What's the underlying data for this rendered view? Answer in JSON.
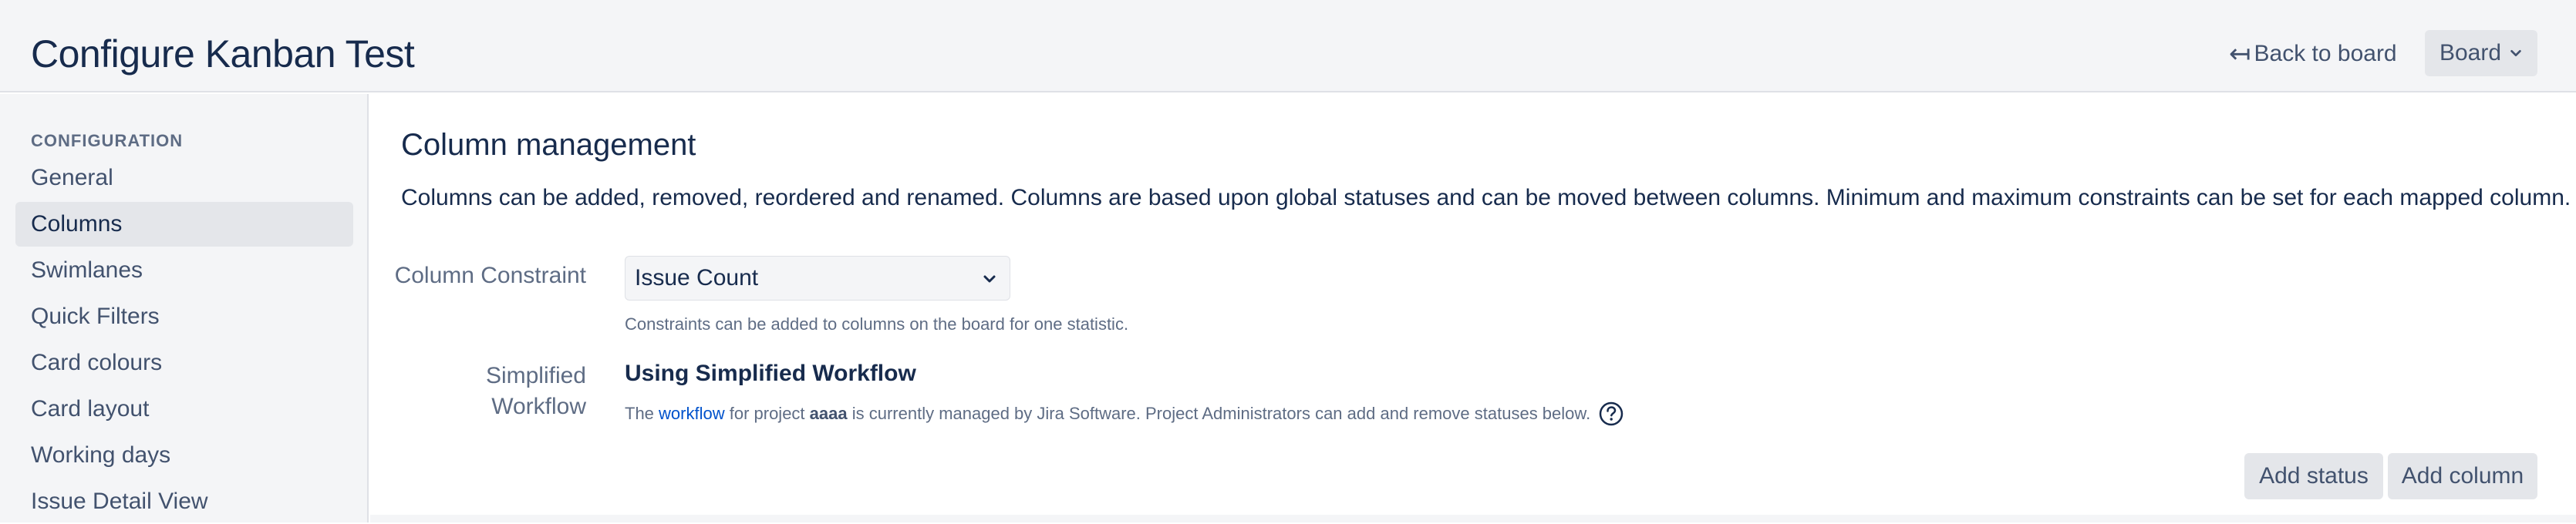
{
  "header": {
    "title": "Configure Kanban Test",
    "back_label": "Back to board",
    "back_arrow": "↤",
    "board_label": "Board"
  },
  "sidebar": {
    "heading": "CONFIGURATION",
    "items": [
      {
        "label": "General"
      },
      {
        "label": "Columns",
        "selected": true
      },
      {
        "label": "Swimlanes"
      },
      {
        "label": "Quick Filters"
      },
      {
        "label": "Card colours"
      },
      {
        "label": "Card layout"
      },
      {
        "label": "Working days"
      },
      {
        "label": "Issue Detail View"
      }
    ]
  },
  "main": {
    "title": "Column management",
    "description": "Columns can be added, removed, reordered and renamed. Columns are based upon global statuses and can be moved between columns. Minimum and maximum constraints can be set for each mapped column.",
    "constraint": {
      "label": "Column Constraint",
      "selected_value": "Issue Count",
      "help_text": "Constraints can be added to columns on the board for one statistic."
    },
    "workflow": {
      "label_line1": "Simplified",
      "label_line2": "Workflow",
      "title": "Using Simplified Workflow",
      "desc_prefix": "The ",
      "desc_link": "workflow",
      "desc_middle": " for project ",
      "desc_project": "aaaa",
      "desc_suffix": " is currently managed by Jira Software. Project Administrators can add and remove statuses below."
    },
    "buttons": {
      "add_status": "Add status",
      "add_column": "Add column"
    }
  },
  "colors": {
    "header_bg": "#f4f5f7",
    "text_primary": "#172b4d",
    "text_secondary": "#5e6c84",
    "link": "#0052cc",
    "button_bg": "#e4e6ea"
  }
}
